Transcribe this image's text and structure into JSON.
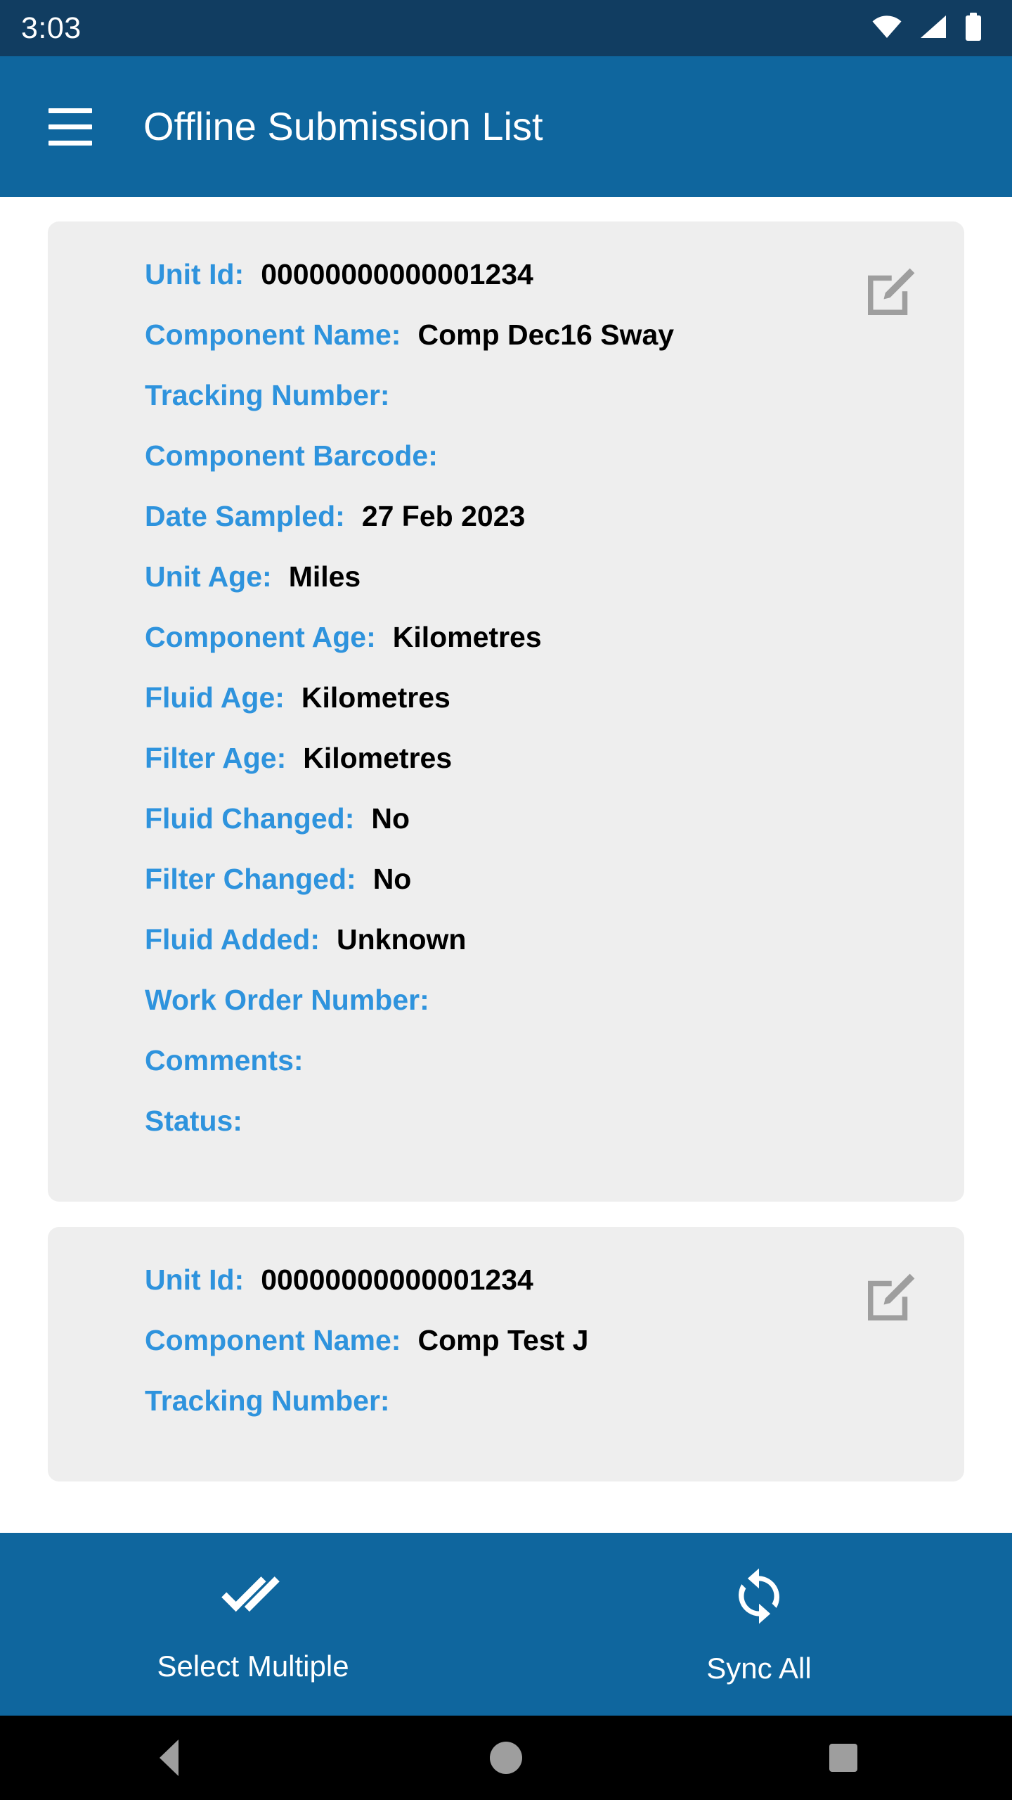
{
  "status_bar": {
    "time": "3:03",
    "icons": [
      "wifi-icon",
      "cellular-signal-icon",
      "battery-icon"
    ],
    "background_color": "#113d61"
  },
  "app_bar": {
    "menu_icon": "hamburger-menu-icon",
    "title": "Offline Submission List",
    "background_color": "#0f669e",
    "text_color": "#ffffff"
  },
  "theme": {
    "label_color": "#2e93dd",
    "value_color": "#000000",
    "card_background": "#eeeeee",
    "page_background": "#ffffff",
    "accent_color": "#0f669e",
    "icon_gray": "#9e9e9e"
  },
  "submissions": [
    {
      "edit_icon": "edit-square-pencil-icon",
      "fields": [
        {
          "label": "Unit Id:",
          "value": "00000000000001234"
        },
        {
          "label": "Component Name:",
          "value": "Comp Dec16 Sway"
        },
        {
          "label": "Tracking Number:",
          "value": ""
        },
        {
          "label": "Component Barcode:",
          "value": ""
        },
        {
          "label": "Date Sampled:",
          "value": "27 Feb 2023"
        },
        {
          "label": "Unit Age:",
          "value": "Miles"
        },
        {
          "label": "Component Age:",
          "value": "Kilometres"
        },
        {
          "label": "Fluid Age:",
          "value": "Kilometres"
        },
        {
          "label": "Filter Age:",
          "value": "Kilometres"
        },
        {
          "label": "Fluid Changed:",
          "value": "No"
        },
        {
          "label": "Filter Changed:",
          "value": "No"
        },
        {
          "label": "Fluid Added:",
          "value": "Unknown"
        },
        {
          "label": "Work Order Number:",
          "value": ""
        },
        {
          "label": "Comments:",
          "value": ""
        },
        {
          "label": "Status:",
          "value": ""
        }
      ]
    },
    {
      "edit_icon": "edit-square-pencil-icon",
      "fields": [
        {
          "label": "Unit Id:",
          "value": "00000000000001234"
        },
        {
          "label": "Component Name:",
          "value": "Comp Test J"
        },
        {
          "label": "Tracking Number:",
          "value": ""
        }
      ]
    }
  ],
  "bottom_bar": {
    "actions": [
      {
        "icon": "double-check-icon",
        "label": "Select Multiple"
      },
      {
        "icon": "sync-refresh-icon",
        "label": "Sync All"
      }
    ]
  },
  "nav_bar": {
    "items": [
      {
        "icon": "back-triangle-icon"
      },
      {
        "icon": "home-circle-icon"
      },
      {
        "icon": "recents-square-icon"
      }
    ]
  }
}
